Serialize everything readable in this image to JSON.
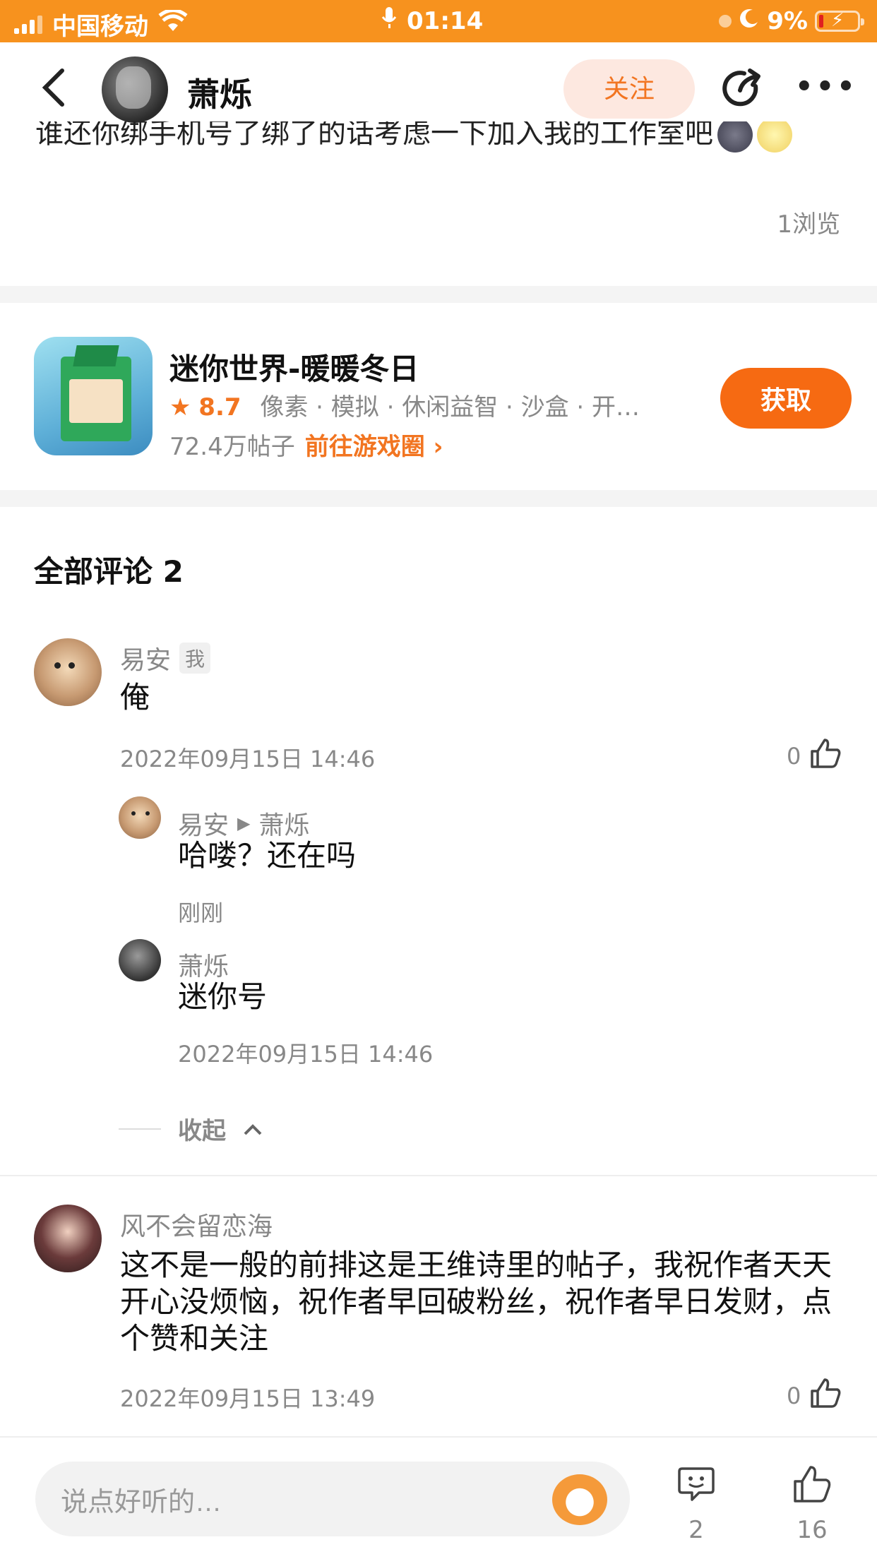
{
  "status_bar": {
    "carrier": "中国移动",
    "time": "01:14",
    "battery": "9%"
  },
  "header": {
    "username": "萧烁",
    "follow_label": "关注"
  },
  "post": {
    "cut_text": "谁还你绑手机号了绑了的话考虑一下加入我的工作室吧",
    "views": "1浏览"
  },
  "game": {
    "name": "迷你世界-暖暖冬日",
    "rating": "8.7",
    "tags": "像素 · 模拟 · 休闲益智 · 沙盒 · 开…",
    "posts": "72.4万帖子",
    "circle_link": "前往游戏圈",
    "get_label": "获取"
  },
  "comments": {
    "title": "全部评论 2",
    "items": [
      {
        "user": "易安",
        "me_badge": "我",
        "text": "俺",
        "time": "2022年09月15日 14:46",
        "likes": "0"
      },
      {
        "user": "风不会留恋海",
        "text": "这不是一般的前排这是王维诗里的帖子，我祝作者天天开心没烦恼，祝作者早回破粉丝，祝作者早日发财，点个赞和关注",
        "time": "2022年09月15日 13:49",
        "likes": "0"
      }
    ],
    "replies": [
      {
        "user": "易安",
        "to": "萧烁",
        "text": "哈喽？还在吗",
        "time": "刚刚"
      },
      {
        "user": "萧烁",
        "text": "迷你号",
        "time": "2022年09月15日 14:46"
      }
    ],
    "collapse_label": "收起"
  },
  "bottom_bar": {
    "placeholder": "说点好听的…",
    "comment_count": "2",
    "like_count": "16"
  },
  "colors": {
    "accent": "#f27521",
    "status_bar": "#f7921e"
  }
}
